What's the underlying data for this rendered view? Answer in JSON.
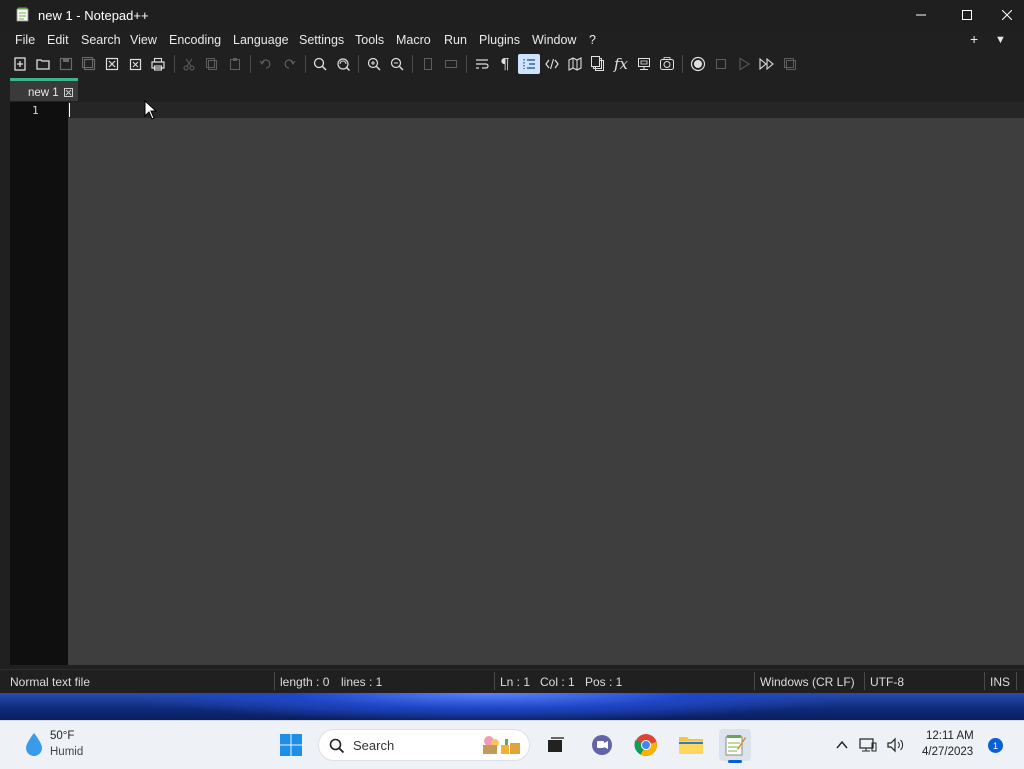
{
  "window": {
    "title": "new 1 - Notepad++"
  },
  "menu": [
    "File",
    "Edit",
    "Search",
    "View",
    "Encoding",
    "Language",
    "Settings",
    "Tools",
    "Macro",
    "Run",
    "Plugins",
    "Window",
    "?"
  ],
  "toolbar": {
    "icons": [
      "new-file",
      "open-file",
      "save",
      "save-all",
      "close",
      "close-all",
      "print",
      "cut",
      "copy",
      "paste",
      "undo",
      "redo",
      "find",
      "replace",
      "zoom-in",
      "zoom-out",
      "sync-vertical",
      "sync-horizontal",
      "word-wrap",
      "show-all-characters",
      "indent-guide",
      "user-defined-language",
      "document-map",
      "document-list",
      "function-list",
      "folder-as-workspace",
      "monitoring",
      "record-macro",
      "stop-recording",
      "playback-macro",
      "run-macro-multiple",
      "save-macro"
    ]
  },
  "tab": {
    "label": "new 1"
  },
  "editor": {
    "line_number": "1"
  },
  "status": {
    "filetype": "Normal text file",
    "length": "length : 0",
    "lines": "lines : 1",
    "ln": "Ln : 1",
    "col": "Col : 1",
    "pos": "Pos : 1",
    "eol": "Windows (CR LF)",
    "encoding": "UTF-8",
    "mode": "INS"
  },
  "taskbar": {
    "weather_temp": "50°F",
    "weather_condition": "Humid",
    "search_label": "Search",
    "time": "12:11 AM",
    "date": "4/27/2023",
    "notification_count": "1"
  },
  "colors": {
    "tab_accent": "#3fb28f",
    "editor_bg": "#3e3e3e",
    "gutter_bg": "#0f0f0f",
    "active_toggle": "#cfe3ff",
    "badge": "#0a5fd1"
  }
}
